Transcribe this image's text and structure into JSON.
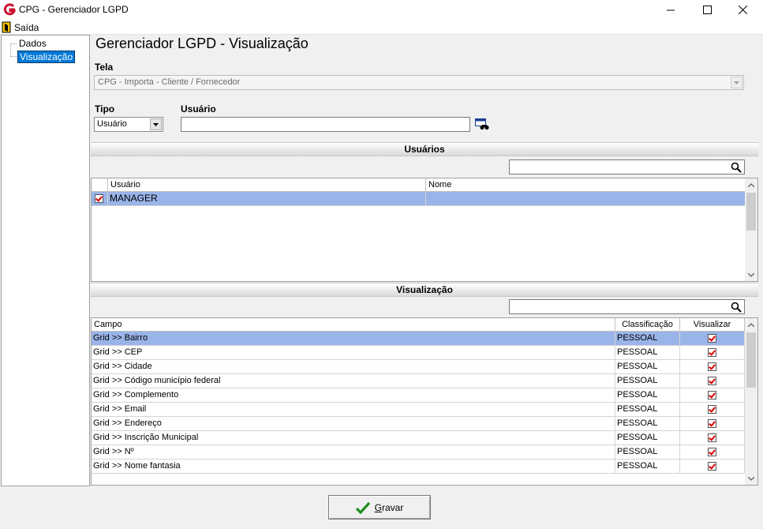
{
  "window": {
    "title": "CPG - Gerenciador LGPD"
  },
  "menu": {
    "exit_label": "Saída"
  },
  "tree": {
    "items": [
      {
        "label": "Dados"
      },
      {
        "label": "Visualização"
      }
    ]
  },
  "page": {
    "title": "Gerenciador LGPD - Visualização"
  },
  "form": {
    "tela_label": "Tela",
    "tela_value": "CPG - Importa - Cliente / Fornecedor",
    "tipo_label": "Tipo",
    "tipo_value": "Usuário",
    "usuario_label": "Usuário",
    "usuario_value": ""
  },
  "usuarios": {
    "header": "Usuários",
    "search_value": "",
    "columns": [
      "Usuário",
      "Nome"
    ],
    "rows": [
      {
        "checked": true,
        "usuario": "MANAGER",
        "nome": ""
      }
    ]
  },
  "visualizacao": {
    "header": "Visualização",
    "search_value": "",
    "columns": [
      "Campo",
      "Classificação",
      "Visualizar"
    ],
    "rows": [
      {
        "campo": "Grid >> Bairro",
        "classificacao": "PESSOAL",
        "visualizar": true
      },
      {
        "campo": "Grid >> CEP",
        "classificacao": "PESSOAL",
        "visualizar": true
      },
      {
        "campo": "Grid >> Cidade",
        "classificacao": "PESSOAL",
        "visualizar": true
      },
      {
        "campo": "Grid >> Código município federal",
        "classificacao": "PESSOAL",
        "visualizar": true
      },
      {
        "campo": "Grid >> Complemento",
        "classificacao": "PESSOAL",
        "visualizar": true
      },
      {
        "campo": "Grid >> Email",
        "classificacao": "PESSOAL",
        "visualizar": true
      },
      {
        "campo": "Grid >> Endereço",
        "classificacao": "PESSOAL",
        "visualizar": true
      },
      {
        "campo": "Grid >> Inscrição Municipal",
        "classificacao": "PESSOAL",
        "visualizar": true
      },
      {
        "campo": "Grid >> Nº",
        "classificacao": "PESSOAL",
        "visualizar": true
      },
      {
        "campo": "Grid >> Nome fantasia",
        "classificacao": "PESSOAL",
        "visualizar": true
      }
    ]
  },
  "actions": {
    "gravar_label": "Gravar"
  },
  "colors": {
    "selection": "#99b4e8",
    "tree_selection": "#0078d7",
    "brand": "#c8102e",
    "check": "#d00000"
  }
}
